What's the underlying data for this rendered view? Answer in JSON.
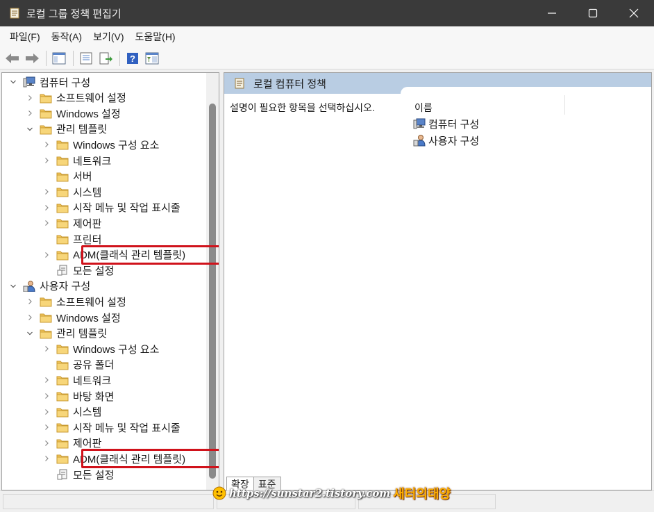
{
  "window": {
    "title": "로컬 그룹 정책 편집기"
  },
  "menu": [
    "파일(F)",
    "동작(A)",
    "보기(V)",
    "도움말(H)"
  ],
  "tree": [
    {
      "label": "컴퓨터 구성",
      "level": 0,
      "chevron": "down",
      "icon": "computer"
    },
    {
      "label": "소프트웨어 설정",
      "level": 1,
      "chevron": "right",
      "icon": "folder"
    },
    {
      "label": "Windows 설정",
      "level": 1,
      "chevron": "right",
      "icon": "folder"
    },
    {
      "label": "관리 템플릿",
      "level": 1,
      "chevron": "down",
      "icon": "folder"
    },
    {
      "label": "Windows 구성 요소",
      "level": 2,
      "chevron": "right",
      "icon": "folder"
    },
    {
      "label": "네트워크",
      "level": 2,
      "chevron": "right",
      "icon": "folder"
    },
    {
      "label": "서버",
      "level": 2,
      "chevron": "none",
      "icon": "folder"
    },
    {
      "label": "시스템",
      "level": 2,
      "chevron": "right",
      "icon": "folder"
    },
    {
      "label": "시작 메뉴 및 작업 표시줄",
      "level": 2,
      "chevron": "right",
      "icon": "folder"
    },
    {
      "label": "제어판",
      "level": 2,
      "chevron": "right",
      "icon": "folder"
    },
    {
      "label": "프린터",
      "level": 2,
      "chevron": "none",
      "icon": "folder"
    },
    {
      "label": "ADM(클래식 관리 템플릿)",
      "level": 2,
      "chevron": "right",
      "icon": "folder",
      "highlighted": true
    },
    {
      "label": "모든 설정",
      "level": 2,
      "chevron": "none",
      "icon": "settings-page"
    },
    {
      "label": "사용자 구성",
      "level": 0,
      "chevron": "down",
      "icon": "user"
    },
    {
      "label": "소프트웨어 설정",
      "level": 1,
      "chevron": "right",
      "icon": "folder"
    },
    {
      "label": "Windows 설정",
      "level": 1,
      "chevron": "right",
      "icon": "folder"
    },
    {
      "label": "관리 템플릿",
      "level": 1,
      "chevron": "down",
      "icon": "folder"
    },
    {
      "label": "Windows 구성 요소",
      "level": 2,
      "chevron": "right",
      "icon": "folder"
    },
    {
      "label": "공유 폴더",
      "level": 2,
      "chevron": "none",
      "icon": "folder"
    },
    {
      "label": "네트워크",
      "level": 2,
      "chevron": "right",
      "icon": "folder"
    },
    {
      "label": "바탕 화면",
      "level": 2,
      "chevron": "right",
      "icon": "folder"
    },
    {
      "label": "시스템",
      "level": 2,
      "chevron": "right",
      "icon": "folder"
    },
    {
      "label": "시작 메뉴 및 작업 표시줄",
      "level": 2,
      "chevron": "right",
      "icon": "folder"
    },
    {
      "label": "제어판",
      "level": 2,
      "chevron": "right",
      "icon": "folder"
    },
    {
      "label": "ADM(클래식 관리 템플릿)",
      "level": 2,
      "chevron": "right",
      "icon": "folder",
      "highlighted": true
    },
    {
      "label": "모든 설정",
      "level": 2,
      "chevron": "none",
      "icon": "settings-page"
    }
  ],
  "right_pane": {
    "header": "로컬 컴퓨터 정책",
    "description": "설명이 필요한 항목을 선택하십시오.",
    "column_name": "이름",
    "items": [
      {
        "label": "컴퓨터 구성",
        "icon": "computer"
      },
      {
        "label": "사용자 구성",
        "icon": "user"
      }
    ]
  },
  "tabs": [
    {
      "label": "확장",
      "active": true
    },
    {
      "label": "표준",
      "active": false
    }
  ],
  "watermark": {
    "url": "https://sunstar2.tistory.com",
    "name": "새터의태양"
  },
  "colors": {
    "titlebar": "#3a3a3a",
    "pane_header": "#b9cde3",
    "highlight": "#d0121b",
    "folder": "#f2c55c"
  }
}
